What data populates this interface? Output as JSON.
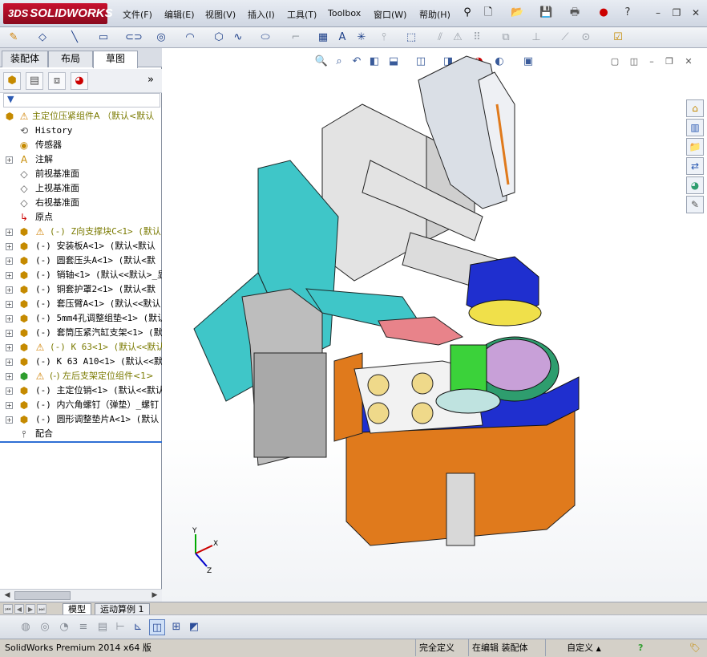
{
  "app": {
    "logo_text": "SOLIDWORKS",
    "logo_mark": "3DS"
  },
  "menu": {
    "items": [
      "文件(F)",
      "编辑(E)",
      "视图(V)",
      "插入(I)",
      "工具(T)",
      "Toolbox",
      "窗口(W)",
      "帮助(H)"
    ]
  },
  "title_icons": [
    "pin-icon",
    "new-icon",
    "open-icon",
    "save-icon",
    "print-icon",
    "rebuild-icon",
    "help-icon"
  ],
  "window_controls": {
    "minimize": "–",
    "restore": "❐",
    "close": "✕"
  },
  "feature_manager": {
    "tabs": [
      "装配体",
      "布局",
      "草图"
    ],
    "active_tab": "草图",
    "expand_arrow": "»",
    "tree": [
      {
        "label": "主定位压紧组件A （默认<默认",
        "type": "root",
        "warn": true
      },
      {
        "label": "History",
        "type": "history"
      },
      {
        "label": "传感器",
        "type": "sensor"
      },
      {
        "label": "注解",
        "type": "annotation",
        "expandable": true
      },
      {
        "label": "前视基准面",
        "type": "plane"
      },
      {
        "label": "上视基准面",
        "type": "plane"
      },
      {
        "label": "右视基准面",
        "type": "plane"
      },
      {
        "label": "原点",
        "type": "origin"
      },
      {
        "label": "(-) Z向支撑块C<1> (默认",
        "type": "part",
        "warn": true
      },
      {
        "label": "(-) 安装板A<1> (默认<默认",
        "type": "part"
      },
      {
        "label": "(-) 圆套压头A<1> (默认<默",
        "type": "part"
      },
      {
        "label": "(-) 销轴<1> (默认<<默认>_显",
        "type": "part"
      },
      {
        "label": "(-) 铜套护罩2<1> (默认<默",
        "type": "part"
      },
      {
        "label": "(-) 套压臂A<1> (默认<<默认",
        "type": "part"
      },
      {
        "label": "(-) 5mm4孔调整组垫<1> (默认,",
        "type": "part"
      },
      {
        "label": "(-) 套筒压紧汽缸支架<1> (默",
        "type": "part"
      },
      {
        "label": "(-) K 63<1> (默认<<默认",
        "type": "part",
        "warn": true
      },
      {
        "label": "(-) K 63 A10<1> (默认<<默认",
        "type": "part"
      },
      {
        "label": "(-) 左后支架定位组件<1>",
        "type": "subasm",
        "warn": true
      },
      {
        "label": "(-) 主定位销<1> (默认<<默认",
        "type": "part"
      },
      {
        "label": "(-) 内六角螺钉（弹垫）_螺钉",
        "type": "part"
      },
      {
        "label": "(-) 圆形调整垫片A<1> (默认",
        "type": "part"
      },
      {
        "label": "配合",
        "type": "mates"
      }
    ]
  },
  "bottom_tabs": [
    "模型",
    "运动算例 1"
  ],
  "status": {
    "product": "SolidWorks Premium 2014 x64 版",
    "definition": "完全定义",
    "mode": "在编辑 装配体",
    "units": "自定义",
    "help_icon": "?"
  },
  "colors": {
    "title_gradient": "#cfd6e2",
    "logo_red": "#c8102e",
    "selection_blue": "#2e6fd4",
    "cyan_plate": "#3fc6c8",
    "orange_block": "#e07a1c",
    "blue_plate": "#1f2fcf",
    "grey_part": "#bdbdbd"
  }
}
